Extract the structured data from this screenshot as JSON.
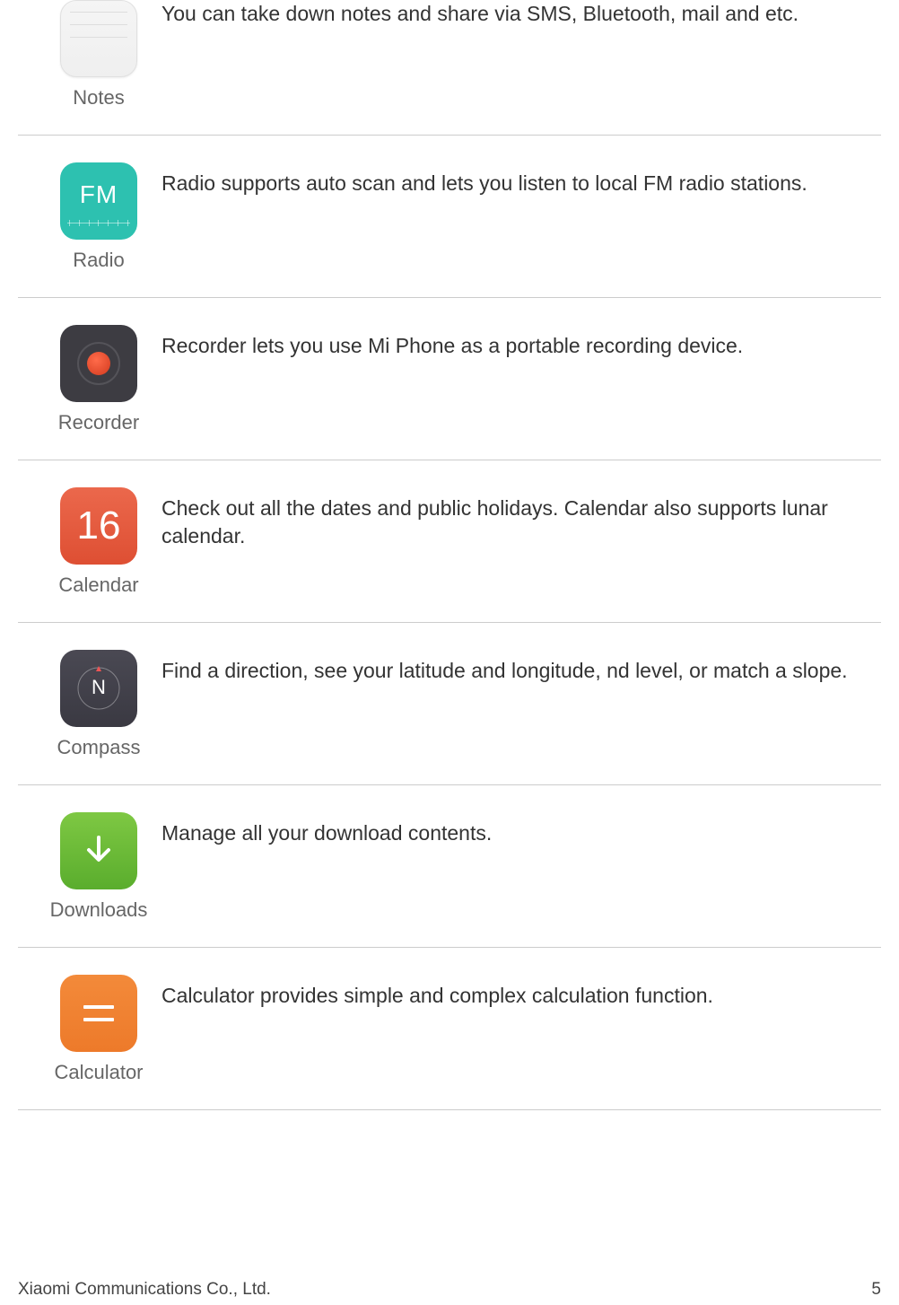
{
  "items": [
    {
      "name": "Notes",
      "description": "You can take down notes and share via SMS, Bluetooth, mail and etc."
    },
    {
      "name": "Radio",
      "description": "Radio supports auto scan and lets you listen to local FM radio stations."
    },
    {
      "name": "Recorder",
      "description": "Recorder lets you use Mi Phone as a portable recording device."
    },
    {
      "name": "Calendar",
      "description": "Check out all the dates and public holidays. Calendar also supports lunar calendar."
    },
    {
      "name": "Compass",
      "description": "Find a direction, see your latitude and longitude, nd level, or match a slope."
    },
    {
      "name": "Downloads",
      "description": "Manage all your download contents."
    },
    {
      "name": "Calculator",
      "description": "Calculator provides simple and complex calculation function."
    }
  ],
  "icon_inner": {
    "radio_text": "FM",
    "calendar_text": "16"
  },
  "footer": {
    "company": "Xiaomi Communications Co., Ltd.",
    "page": "5"
  }
}
